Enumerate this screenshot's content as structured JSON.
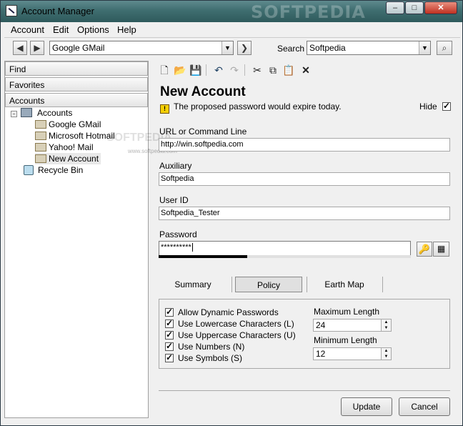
{
  "window": {
    "title": "Account Manager",
    "watermark": "SOFTPEDIA"
  },
  "menu": [
    "Account",
    "Edit",
    "Options",
    "Help"
  ],
  "nav": {
    "selected_account": "Google GMail",
    "search_label": "Search",
    "search_value": "Softpedia"
  },
  "sidebar": {
    "find": "Find",
    "favorites": "Favorites",
    "accounts": "Accounts",
    "tree_root": "Accounts",
    "items": [
      "Google GMail",
      "Microsoft Hotmail",
      "Yahoo! Mail",
      "New Account"
    ],
    "recycle": "Recycle Bin",
    "watermark_text": "SOFTPEDIA",
    "watermark_url": "www.softpedia.com"
  },
  "form": {
    "heading": "New Account",
    "warning": "The proposed password would expire today.",
    "hide_label": "Hide",
    "url_label": "URL or Command Line",
    "url_value": "http://win.softpedia.com",
    "aux_label": "Auxiliary",
    "aux_value": "Softpedia",
    "userid_label": "User ID",
    "userid_value": "Softpedia_Tester",
    "password_label": "Password",
    "password_value": "**********",
    "strength": 0.35
  },
  "tabs": [
    "Summary",
    "Policy",
    "Earth Map"
  ],
  "policy": {
    "checks": [
      "Allow Dynamic Passwords",
      "Use Lowercase Characters (L)",
      "Use Uppercase Characters (U)",
      "Use Numbers (N)",
      "Use Symbols (S)"
    ],
    "max_label": "Maximum Length",
    "max_value": "24",
    "min_label": "Minimum Length",
    "min_value": "12"
  },
  "buttons": {
    "update": "Update",
    "cancel": "Cancel"
  }
}
